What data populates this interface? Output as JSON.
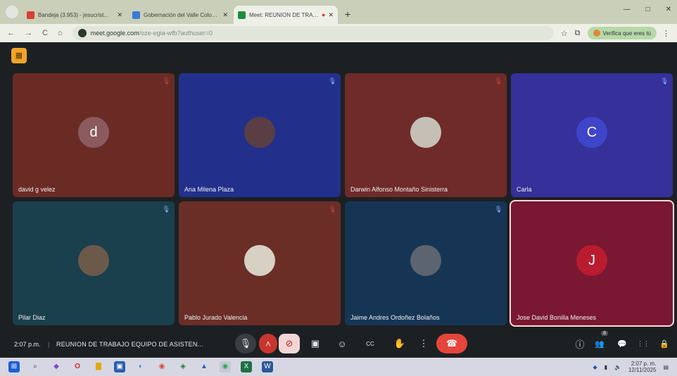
{
  "browser": {
    "tabs": [
      {
        "label": "Bandeja (3.953) - jesucrist...",
        "favicon_color": "#d84032",
        "active": false
      },
      {
        "label": "Gobernación del Valle Colomb...",
        "favicon_color": "#3a7bd5",
        "active": false
      },
      {
        "label": "Meet: REUNION DE TRABA",
        "favicon_color": "#1e8e3e",
        "active": true
      }
    ],
    "menu_icon": "chevron-down-icon",
    "new_tab": "+",
    "window_controls": [
      "—",
      "□",
      "✕"
    ],
    "nav": {
      "back": "←",
      "forward": "→",
      "reload": "C",
      "home": "⌂"
    },
    "url_host": "meet.google.com",
    "url_path": "/oze-egia-wfb?authuser=0",
    "verify_label": "Verifica que eres tú",
    "menu_dots": "⋮"
  },
  "meet": {
    "logo_glyph": "▦",
    "participants": [
      {
        "name": "david g velez",
        "initial": "d",
        "avatar_color": "#8a5a5c",
        "tile_color": "#6b2b25",
        "mic_color": "#c7463f"
      },
      {
        "name": "Ana Milena Plaza",
        "initial": "",
        "avatar_color": "#5a3e44",
        "tile_color": "#22308c",
        "mic_color": "#8fb0ff"
      },
      {
        "name": "Darwin Alfonso Montaño Sinisterra",
        "initial": "",
        "avatar_color": "#c5c0b6",
        "tile_color": "#6f2b2a",
        "mic_color": "#c7463f"
      },
      {
        "name": "Carla",
        "initial": "C",
        "avatar_color": "#3f45c9",
        "tile_color": "#35309a",
        "mic_color": "#8fb0ff"
      },
      {
        "name": "Pilar Diaz",
        "initial": "",
        "avatar_color": "#6b5a4a",
        "tile_color": "#1a3f4d",
        "mic_color": "#8fb0ff"
      },
      {
        "name": "Pablo Jurado Valencia",
        "initial": "",
        "avatar_color": "#d9d0c4",
        "tile_color": "#6a2e27",
        "mic_color": "#c7463f"
      },
      {
        "name": "Jaime Andres Ordoñez Bolaños",
        "initial": "",
        "avatar_color": "#5c6470",
        "tile_color": "#163555",
        "mic_color": "#8fb0ff"
      },
      {
        "name": "Jose David Bonilla Meneses",
        "initial": "J",
        "avatar_color": "#b81c2e",
        "tile_color": "#7a1732",
        "mic_color": "#8fb0ff"
      }
    ],
    "time": "2:07 p.m.",
    "separator": "|",
    "meeting_title": "REUNION DE TRABAJO EQUIPO DE ASISTEN...",
    "controls": {
      "mic": "🎙",
      "mic_options": "˄",
      "camera_off": "⊘",
      "present": "▣",
      "emoji": "☺",
      "captions": "CC",
      "raise_hand": "✋",
      "more": "⋮",
      "end_call": "☎",
      "info": "ⓘ",
      "people": "👥",
      "chat": "💬",
      "activities": "⋮⋮",
      "host": "🔒",
      "people_count": "8"
    }
  },
  "taskbar": {
    "apps": [
      {
        "icon": "windows-start-icon",
        "glyph": "⊞",
        "color": "#1d5fd1"
      },
      {
        "icon": "search-icon",
        "glyph": "⌕",
        "color": "#333"
      },
      {
        "icon": "copilot-icon",
        "glyph": "◆",
        "color": "#8844cc"
      },
      {
        "icon": "opera-icon",
        "glyph": "O",
        "color": "#d8232a"
      },
      {
        "icon": "explorer-icon",
        "glyph": "▇",
        "color": "#e0a800"
      },
      {
        "icon": "store-icon",
        "glyph": "▣",
        "color": "#2a5db0"
      },
      {
        "icon": "edge-icon",
        "glyph": "◐",
        "color": "#1a8fd6"
      },
      {
        "icon": "chrome-icon",
        "glyph": "◉",
        "color": "#d9472b"
      },
      {
        "icon": "app-icon",
        "glyph": "◈",
        "color": "#1f7a3a"
      },
      {
        "icon": "app-icon-2",
        "glyph": "▲",
        "color": "#2f5dbf"
      },
      {
        "icon": "chrome-profile-icon",
        "glyph": "◉",
        "color": "#2ba84a"
      },
      {
        "icon": "excel-icon",
        "glyph": "X",
        "color": "#1d7044"
      },
      {
        "icon": "word-icon",
        "glyph": "W",
        "color": "#2b579a"
      }
    ],
    "clock_time": "2:07 p. m.",
    "clock_date": "12/11/2025"
  }
}
